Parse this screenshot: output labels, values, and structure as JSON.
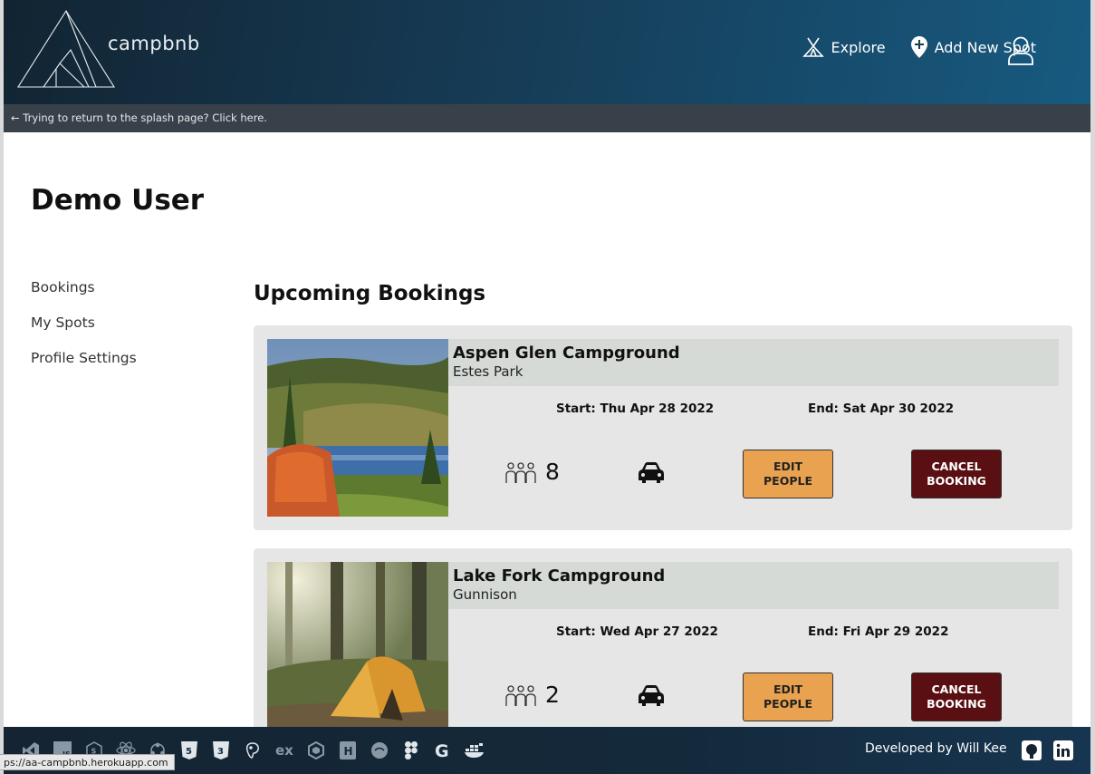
{
  "brand": {
    "name": "campbnb"
  },
  "nav": {
    "explore": "Explore",
    "add_spot": "Add New Spot"
  },
  "banner": {
    "text": "← Trying to return to the splash page? Click here."
  },
  "user": {
    "name": "Demo User"
  },
  "sidebar": {
    "items": [
      {
        "label": "Bookings"
      },
      {
        "label": "My Spots"
      },
      {
        "label": "Profile Settings"
      }
    ]
  },
  "section": {
    "title": "Upcoming Bookings"
  },
  "bookings": [
    {
      "name": "Aspen Glen Campground",
      "location": "Estes Park",
      "start": "Start: Thu Apr 28 2022",
      "end": "End: Sat Apr 30 2022",
      "people": "8",
      "edit_label": "EDIT PEOPLE",
      "cancel_label": "CANCEL BOOKING"
    },
    {
      "name": "Lake Fork Campground",
      "location": "Gunnison",
      "start": "Start: Wed Apr 27 2022",
      "end": "End: Fri Apr 29 2022",
      "people": "2",
      "edit_label": "EDIT PEOPLE",
      "cancel_label": "CANCEL BOOKING"
    }
  ],
  "footer": {
    "credit": "Developed by Will Kee",
    "tech_icons": [
      "vscode-icon",
      "js-icon",
      "sequelize-icon",
      "react-icon",
      "redux-icon",
      "html5-icon",
      "css3-icon",
      "postgresql-icon",
      "express-icon",
      "nodejs-icon",
      "heroku-icon",
      "git-icon",
      "figma-icon",
      "google-icon",
      "docker-icon"
    ]
  },
  "status_bar": {
    "url": "ps://aa-campbnb.herokuapp.com"
  },
  "colors": {
    "header_start": "#122432",
    "header_end": "#175a80",
    "edit_button": "#e9a24f",
    "cancel_button": "#5a0f12",
    "card_bg": "#e6e6e6"
  }
}
